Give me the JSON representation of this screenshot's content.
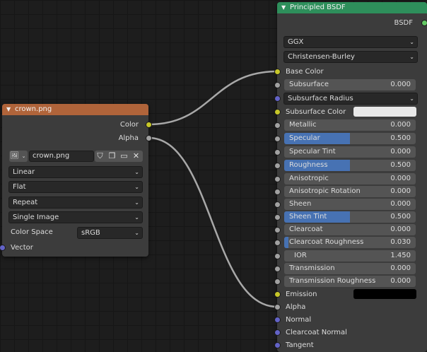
{
  "image_node": {
    "title": "crown.png",
    "header_color": "#b0643a",
    "outputs": [
      "Color",
      "Alpha"
    ],
    "image_name": "crown.png",
    "interpolation": "Linear",
    "projection": "Flat",
    "extension": "Repeat",
    "source": "Single Image",
    "color_space_label": "Color Space",
    "color_space_value": "sRGB",
    "input_vector": "Vector"
  },
  "bsdf_node": {
    "title": "Principled BSDF",
    "header_color": "#2e8f5b",
    "output": "BSDF",
    "distribution": "GGX",
    "subsurface_method": "Christensen-Burley",
    "base_color_label": "Base Color",
    "subsurface": {
      "label": "Subsurface",
      "value": "0.000"
    },
    "subsurface_radius": "Subsurface Radius",
    "subsurface_color": {
      "label": "Subsurface Color",
      "color": "#e8e8e8"
    },
    "metallic": {
      "label": "Metallic",
      "value": "0.000",
      "fraction": 0
    },
    "specular": {
      "label": "Specular",
      "value": "0.500",
      "fraction": 0.5
    },
    "specular_tint": {
      "label": "Specular Tint",
      "value": "0.000",
      "fraction": 0
    },
    "roughness": {
      "label": "Roughness",
      "value": "0.500",
      "fraction": 0.5
    },
    "anisotropic": {
      "label": "Anisotropic",
      "value": "0.000",
      "fraction": 0
    },
    "anisotropic_rotation": {
      "label": "Anisotropic Rotation",
      "value": "0.000",
      "fraction": 0
    },
    "sheen": {
      "label": "Sheen",
      "value": "0.000",
      "fraction": 0
    },
    "sheen_tint": {
      "label": "Sheen Tint",
      "value": "0.500",
      "fraction": 0.5
    },
    "clearcoat": {
      "label": "Clearcoat",
      "value": "0.000",
      "fraction": 0
    },
    "clearcoat_roughness": {
      "label": "Clearcoat Roughness",
      "value": "0.030",
      "fraction": 0.03
    },
    "ior": {
      "label": "IOR",
      "value": "1.450"
    },
    "transmission": {
      "label": "Transmission",
      "value": "0.000",
      "fraction": 0
    },
    "transmission_roughness": {
      "label": "Transmission Roughness",
      "value": "0.000",
      "fraction": 0
    },
    "emission": {
      "label": "Emission",
      "color": "#000000"
    },
    "alpha_label": "Alpha",
    "normal_label": "Normal",
    "clearcoat_normal_label": "Clearcoat Normal",
    "tangent_label": "Tangent"
  },
  "colors": {
    "link": "#a8a8a8",
    "field_fill": "#4772b3",
    "socket_color": "#c7c729",
    "socket_float": "#a1a1a1",
    "socket_vector": "#6363c7",
    "socket_shader": "#63c763"
  }
}
